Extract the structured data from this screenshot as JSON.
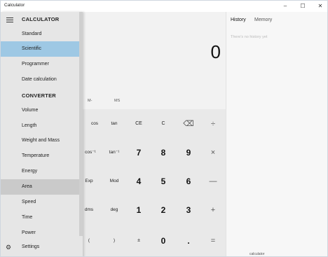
{
  "window": {
    "title": "Calculator",
    "controls": {
      "minimize": "–",
      "maximize": "☐",
      "close": "✕"
    }
  },
  "nav": {
    "calculator_heading": "CALCULATOR",
    "calculator_items": [
      "Standard",
      "Scientific",
      "Programmer",
      "Date calculation"
    ],
    "converter_heading": "CONVERTER",
    "converter_items": [
      "Volume",
      "Length",
      "Weight and Mass",
      "Temperature",
      "Energy",
      "Area",
      "Speed",
      "Time",
      "Power"
    ],
    "settings": "Settings",
    "selected": "Scientific",
    "hovered": "Area"
  },
  "display": {
    "value": "0"
  },
  "memory": {
    "minus": "M-",
    "store": "MS"
  },
  "keys": {
    "row1": [
      "cos",
      "tan",
      "CE",
      "C",
      "⌫",
      "÷"
    ],
    "row2": [
      "cos⁻¹",
      "tan⁻¹",
      "7",
      "8",
      "9",
      "×"
    ],
    "row3": [
      "Exp",
      "Mod",
      "4",
      "5",
      "6",
      "—"
    ],
    "row4": [
      "dms",
      "deg",
      "1",
      "2",
      "3",
      "+"
    ],
    "row5": [
      "(",
      ")",
      "±",
      "0",
      ".",
      "="
    ]
  },
  "side_panel": {
    "tab_history": "History",
    "tab_memory": "Memory",
    "empty_message": "There's no history yet"
  },
  "bottom_hint": "calculator"
}
